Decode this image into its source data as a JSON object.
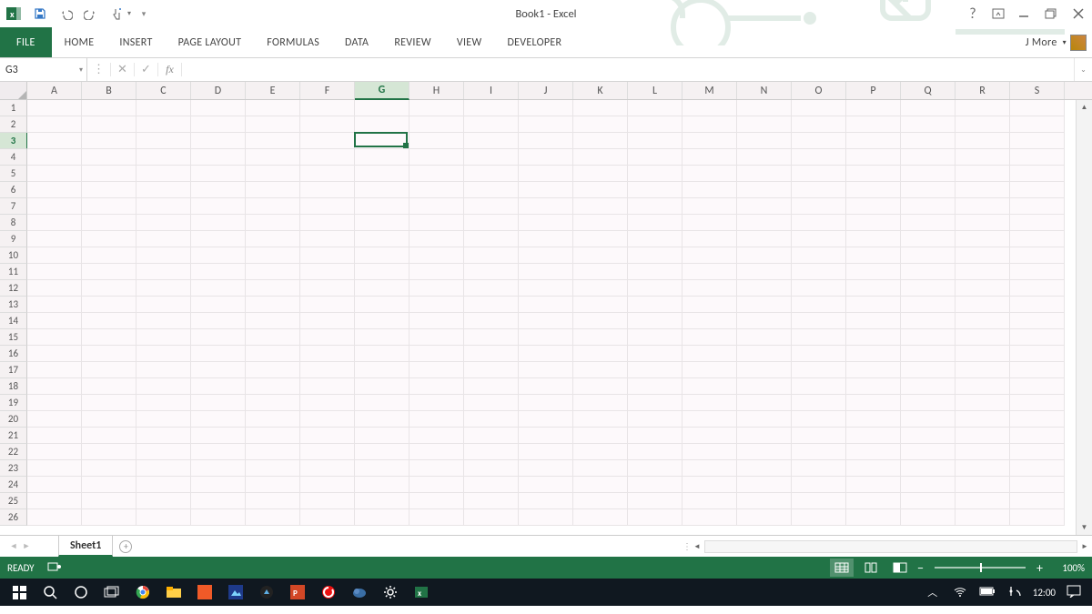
{
  "title": "Book1 - Excel",
  "user_label": "J More",
  "ribbon": {
    "file": "FILE",
    "tabs": [
      "HOME",
      "INSERT",
      "PAGE LAYOUT",
      "FORMULAS",
      "DATA",
      "REVIEW",
      "VIEW",
      "DEVELOPER"
    ]
  },
  "name_box": "G3",
  "formula": "",
  "columns": [
    "A",
    "B",
    "C",
    "D",
    "E",
    "F",
    "G",
    "H",
    "I",
    "J",
    "K",
    "L",
    "M",
    "N",
    "O",
    "P",
    "Q",
    "R",
    "S"
  ],
  "selected_column_index": 6,
  "rows": [
    1,
    2,
    3,
    4,
    5,
    6,
    7,
    8,
    9,
    10,
    11,
    12,
    13,
    14,
    15,
    16,
    17,
    18,
    19,
    20,
    21,
    22,
    23,
    24,
    25,
    26
  ],
  "selected_row_index": 2,
  "sheet_tab": "Sheet1",
  "status": "READY",
  "zoom": "100%",
  "clock": "12:00"
}
